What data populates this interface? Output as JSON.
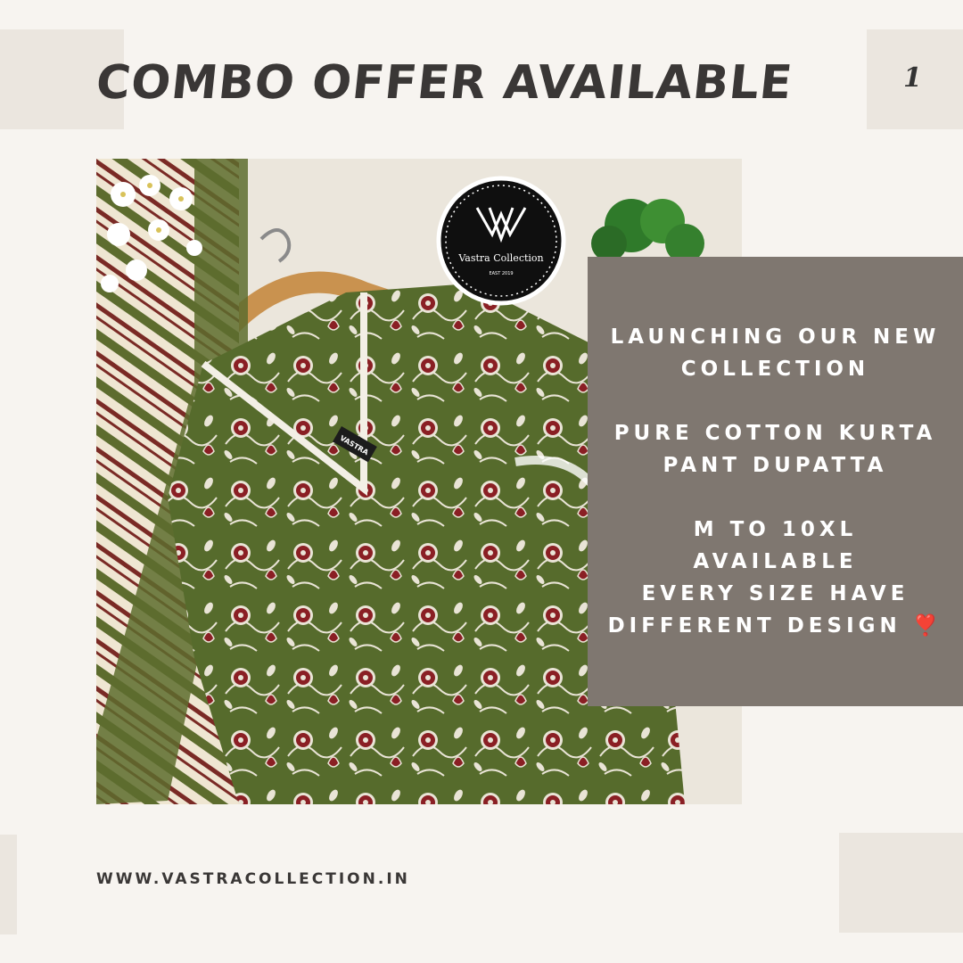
{
  "header": {
    "headline": "COMBO OFFER AVAILABLE",
    "page_number": "1"
  },
  "photo": {
    "brand_badge_text": "Vastra Collection",
    "brand_badge_sub": "EAST 2019",
    "hang_tag_text": "VASTRA"
  },
  "info": {
    "line1": "LAUNCHING OUR NEW",
    "line2": "COLLECTION",
    "line3": "PURE COTTON KURTA",
    "line4": "PANT DUPATTA",
    "line5": "M TO 10XL",
    "line6": "AVAILABLE",
    "line7": "EVERY SIZE HAVE",
    "line8": "DIFFERENT DESIGN",
    "emoji": "❣️"
  },
  "footer": {
    "website": "WWW.VASTRACOLLECTION.IN"
  },
  "colors": {
    "background": "#f7f4f0",
    "deco_block": "#ebe6df",
    "info_box": "#7f7770",
    "fabric_green": "#566b2c",
    "print_maroon": "#8a1f24",
    "text_dark": "#3a3736"
  }
}
